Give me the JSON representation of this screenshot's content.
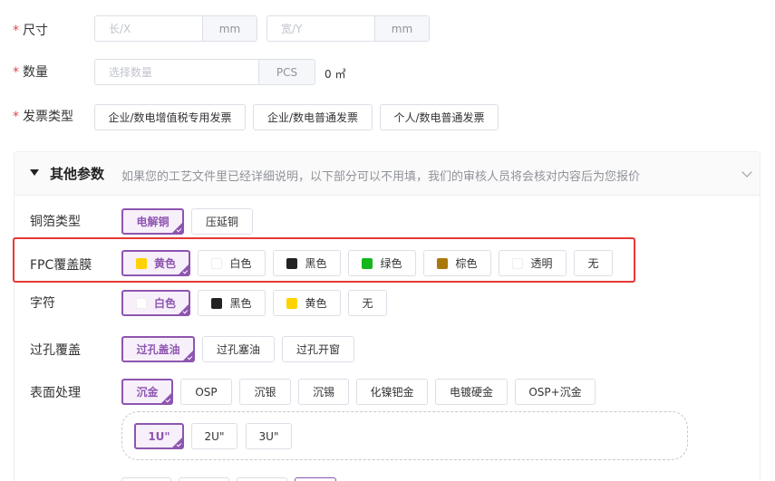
{
  "size": {
    "label": "尺寸",
    "length_placeholder": "长/X",
    "width_placeholder": "宽/Y",
    "unit": "mm"
  },
  "quantity": {
    "label": "数量",
    "placeholder": "选择数量",
    "unit": "PCS",
    "area": "0 ㎡"
  },
  "invoice": {
    "label": "发票类型",
    "options": [
      "企业/数电增值税专用发票",
      "企业/数电普通发票",
      "个人/数电普通发票"
    ]
  },
  "panel": {
    "title": "其他参数",
    "desc": "如果您的工艺文件里已经详细说明，以下部分可以不用填，我们的审核人员将会核对内容后为您报价"
  },
  "copper": {
    "label": "铜箔类型",
    "options": [
      "电解铜",
      "压延铜"
    ],
    "selected": "电解铜"
  },
  "coverlay": {
    "label": "FPC覆盖膜",
    "options": [
      {
        "label": "黄色",
        "color": "#ffd200"
      },
      {
        "label": "白色",
        "color": "#ffffff"
      },
      {
        "label": "黑色",
        "color": "#222222"
      },
      {
        "label": "绿色",
        "color": "#14b61b"
      },
      {
        "label": "棕色",
        "color": "#a8780d"
      },
      {
        "label": "透明",
        "color": "#ffffff"
      },
      {
        "label": "无",
        "color": ""
      }
    ],
    "selected": "黄色"
  },
  "silkscreen": {
    "label": "字符",
    "options": [
      {
        "label": "白色",
        "color": "#ffffff"
      },
      {
        "label": "黑色",
        "color": "#222222"
      },
      {
        "label": "黄色",
        "color": "#ffd200"
      },
      {
        "label": "无",
        "color": ""
      }
    ],
    "selected": "白色"
  },
  "via": {
    "label": "过孔覆盖",
    "options": [
      "过孔盖油",
      "过孔塞油",
      "过孔开窗"
    ],
    "selected": "过孔盖油"
  },
  "finish": {
    "label": "表面处理",
    "options": [
      "沉金",
      "OSP",
      "沉银",
      "沉锡",
      "化镍钯金",
      "电镀硬金",
      "OSP+沉金"
    ],
    "selected": "沉金",
    "thickness": {
      "options": [
        "1U\"",
        "2U\"",
        "3U\""
      ],
      "selected": "1U\""
    }
  },
  "colors": {
    "accent": "#8e55b0",
    "required": "#e0474b",
    "highlight": "#e53935"
  }
}
